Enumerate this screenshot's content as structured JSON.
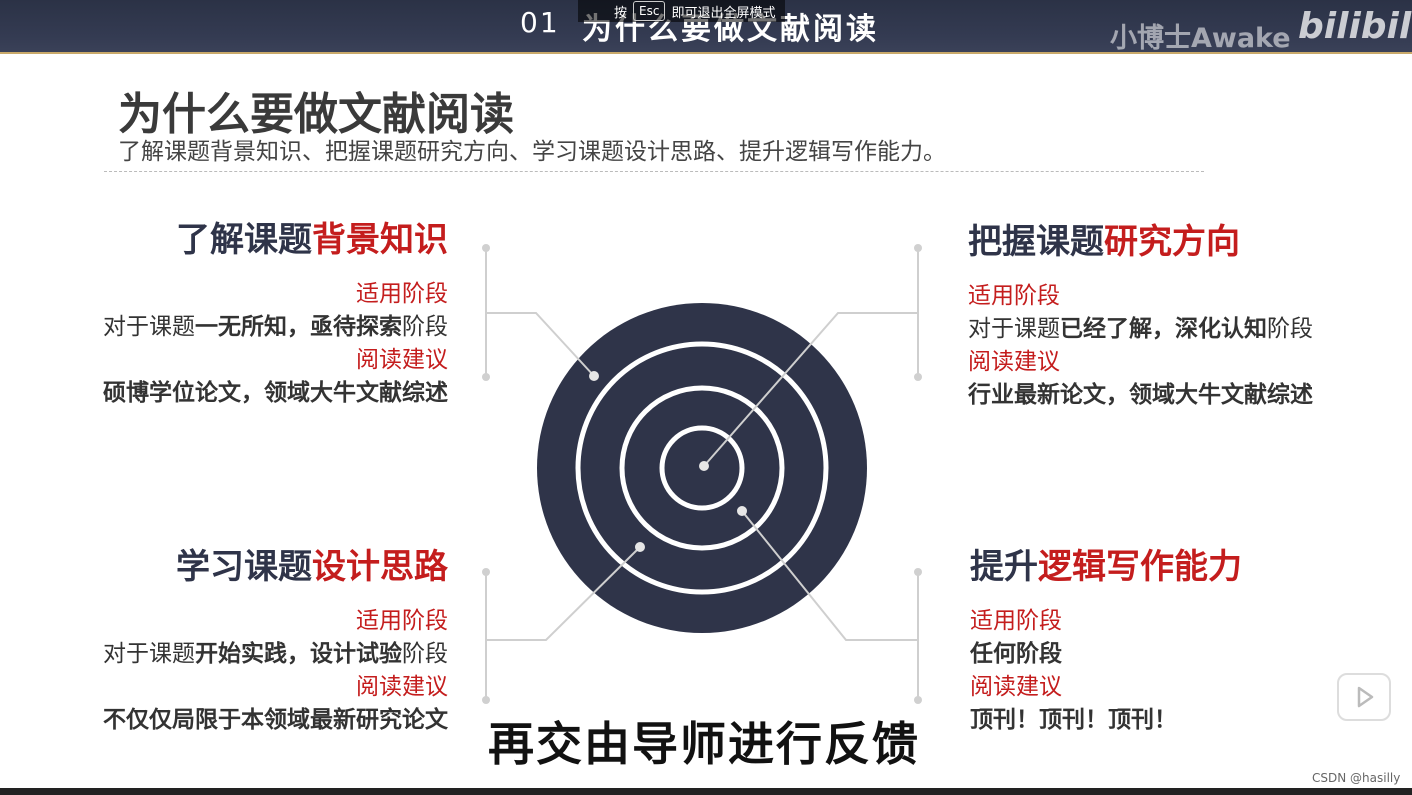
{
  "banner": {
    "number": "01",
    "title": "为什么要做文献阅读",
    "esc_prefix": "按",
    "esc_key": "Esc",
    "esc_suffix": "即可退出全屏模式",
    "watermark": "小博士Awake",
    "logo": "bilibili"
  },
  "heading": {
    "title": "为什么要做文献阅读",
    "subtitle": "了解课题背景知识、把握课题研究方向、学习课题设计思路、提升逻辑写作能力。"
  },
  "quadrants": {
    "tl": {
      "title_a": "了解课题",
      "title_b": "背景知识",
      "stage_label": "适用阶段",
      "stage_pre": "对于课题",
      "stage_b1": "一无所知",
      "stage_sep": "，",
      "stage_b2": "亟待探索",
      "stage_post": "阶段",
      "advice_label": "阅读建议",
      "advice": "硕博学位论文，领域大牛文献综述"
    },
    "tr": {
      "title_a": "把握课题",
      "title_b": "研究方向",
      "stage_label": "适用阶段",
      "stage_pre": "对于课题",
      "stage_b1": "已经了解",
      "stage_sep": "，",
      "stage_b2": "深化认知",
      "stage_post": "阶段",
      "advice_label": "阅读建议",
      "advice": "行业最新论文，领域大牛文献综述"
    },
    "bl": {
      "title_a": "学习课题",
      "title_b": "设计思路",
      "stage_label": "适用阶段",
      "stage_pre": "对于课题",
      "stage_b1": "开始实践",
      "stage_sep": "，",
      "stage_b2": "设计试验",
      "stage_post": "阶段",
      "advice_label": "阅读建议",
      "advice": "不仅仅局限于本领域最新研究论文"
    },
    "br": {
      "title_a": "提升",
      "title_b": "逻辑写作能力",
      "stage_label": "适用阶段",
      "stage": "任何阶段",
      "advice_label": "阅读建议",
      "advice": "顶刊！顶刊！顶刊！"
    }
  },
  "caption": "再交由导师进行反馈",
  "csdn": "CSDN @hasilly",
  "colors": {
    "navy": "#2f3449",
    "red": "#c41d1d"
  }
}
